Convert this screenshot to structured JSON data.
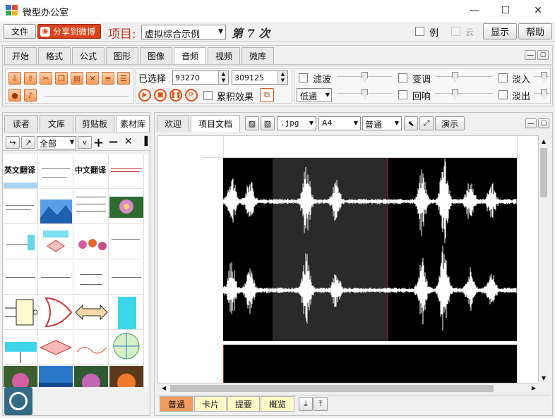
{
  "window": {
    "title": "微型办公室",
    "minimize": "—",
    "maximize": "☐",
    "close": "✕"
  },
  "menubar": {
    "file": "文件",
    "share": "分享到微博",
    "project_label": "项目:",
    "project_value": "虚拟综合示例",
    "count_text": "第 7 次",
    "example_label": "例",
    "cloud_label": "云",
    "display": "显示",
    "help": "帮助"
  },
  "ribbon_tabs": [
    "开始",
    "格式",
    "公式",
    "图形",
    "图像",
    "音频",
    "视频",
    "微库"
  ],
  "ribbon_active": "音频",
  "audio": {
    "selected_label": "已选择",
    "start_value": "93270",
    "end_value": "309125",
    "accumulate_label": "累积效果",
    "filter_label": "滤波",
    "filter_type": "低通",
    "pitch_label": "变调",
    "echo_label": "回响",
    "fadein_label": "淡入",
    "fadeout_label": "淡出"
  },
  "left_tabs": [
    "读者",
    "文库",
    "剪贴板",
    "素材库"
  ],
  "left_active": "素材库",
  "left_toolbar": {
    "filter_value": "全部",
    "small_drop": "v"
  },
  "thumbs": {
    "t1": "英文翻译",
    "t2": "中文翻译"
  },
  "doc_tabs": [
    "欢迎",
    "项目文档"
  ],
  "doc_active": "项目文档",
  "doc_toolbar": {
    "format": ".jpg",
    "paper": "A4",
    "mode": "普通",
    "present": "演示"
  },
  "waveform": {
    "background": "#000000",
    "selection_color": "#2a2a2a",
    "marker_color": "#b0202a",
    "wave_color": "#ffffff"
  },
  "bottom_tabs": [
    "普通",
    "卡片",
    "提要",
    "概览"
  ],
  "bottom_active": "普通",
  "colors": {
    "accent": "#f29a61",
    "share_bg": "#d9431b",
    "project_text": "#c0392b"
  }
}
